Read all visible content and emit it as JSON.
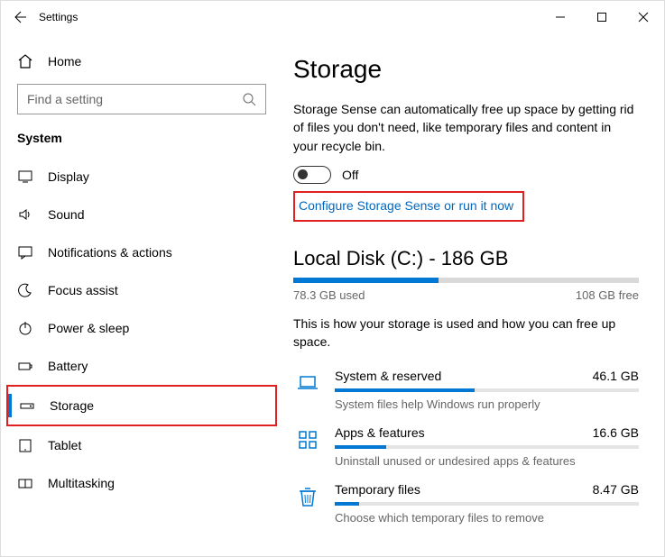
{
  "window": {
    "title": "Settings"
  },
  "sidebar": {
    "home": "Home",
    "search_placeholder": "Find a setting",
    "section": "System",
    "items": [
      {
        "label": "Display"
      },
      {
        "label": "Sound"
      },
      {
        "label": "Notifications & actions"
      },
      {
        "label": "Focus assist"
      },
      {
        "label": "Power & sleep"
      },
      {
        "label": "Battery"
      },
      {
        "label": "Storage"
      },
      {
        "label": "Tablet"
      },
      {
        "label": "Multitasking"
      }
    ]
  },
  "page": {
    "title": "Storage",
    "description": "Storage Sense can automatically free up space by getting rid of files you don't need, like temporary files and content in your recycle bin.",
    "toggle_state": "Off",
    "config_link": "Configure Storage Sense or run it now",
    "disk": {
      "title": "Local Disk (C:) - 186 GB",
      "used": "78.3 GB used",
      "free": "108 GB free",
      "fill_pct": 42
    },
    "usage_desc": "This is how your storage is used and how you can free up space.",
    "categories": [
      {
        "name": "System & reserved",
        "size": "46.1 GB",
        "hint": "System files help Windows run properly",
        "fill_pct": 46
      },
      {
        "name": "Apps & features",
        "size": "16.6 GB",
        "hint": "Uninstall unused or undesired apps & features",
        "fill_pct": 17
      },
      {
        "name": "Temporary files",
        "size": "8.47 GB",
        "hint": "Choose which temporary files to remove",
        "fill_pct": 8
      }
    ]
  }
}
